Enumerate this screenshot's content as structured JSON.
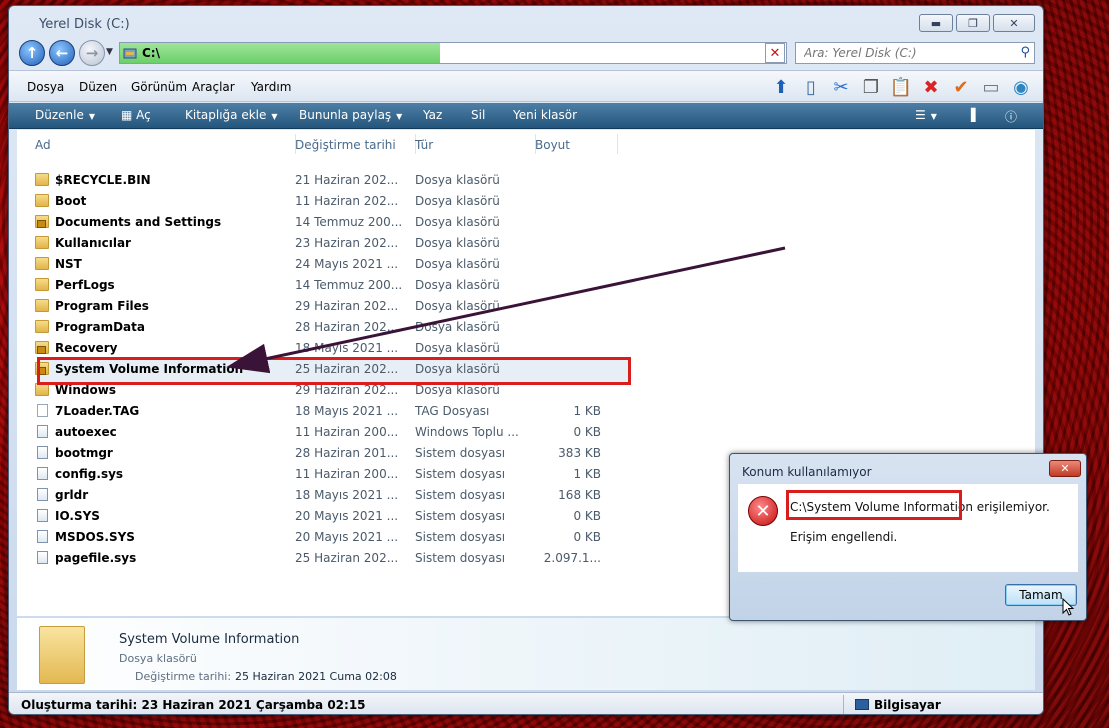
{
  "window": {
    "title": "Yerel Disk (C:)",
    "caption": {
      "minimize": "▬",
      "maximize": "❐",
      "close": "✕"
    }
  },
  "address": {
    "path": "C:\\",
    "search_placeholder": "Ara: Yerel Disk (C:)"
  },
  "menubar": [
    "Dosya",
    "Düzen",
    "Görünüm",
    "Araçlar",
    "Yardım"
  ],
  "commands": {
    "organize": "Düzenle",
    "open": "Aç",
    "library": "Kitaplığa ekle",
    "share": "Bununla paylaş",
    "print": "Yaz",
    "delete": "Sil",
    "new_folder": "Yeni klasör"
  },
  "columns": {
    "name": "Ad",
    "date": "Değiştirme tarihi",
    "type": "Tür",
    "size": "Boyut"
  },
  "files": [
    {
      "name": "$RECYCLE.BIN",
      "date": "21 Haziran 202...",
      "type": "Dosya klasörü",
      "size": "",
      "icon": "folder"
    },
    {
      "name": "Boot",
      "date": "11 Haziran 202...",
      "type": "Dosya klasörü",
      "size": "",
      "icon": "folder"
    },
    {
      "name": "Documents and Settings",
      "date": "14 Temmuz 200...",
      "type": "Dosya klasörü",
      "size": "",
      "icon": "locked-folder"
    },
    {
      "name": "Kullanıcılar",
      "date": "23 Haziran 202...",
      "type": "Dosya klasörü",
      "size": "",
      "icon": "folder"
    },
    {
      "name": "NST",
      "date": "24 Mayıs 2021 ...",
      "type": "Dosya klasörü",
      "size": "",
      "icon": "folder"
    },
    {
      "name": "PerfLogs",
      "date": "14 Temmuz 200...",
      "type": "Dosya klasörü",
      "size": "",
      "icon": "folder"
    },
    {
      "name": "Program Files",
      "date": "29 Haziran 202...",
      "type": "Dosya klasörü",
      "size": "",
      "icon": "folder"
    },
    {
      "name": "ProgramData",
      "date": "28 Haziran 202...",
      "type": "Dosya klasörü",
      "size": "",
      "icon": "folder"
    },
    {
      "name": "Recovery",
      "date": "18 Mayıs 2021 ...",
      "type": "Dosya klasörü",
      "size": "",
      "icon": "locked-folder"
    },
    {
      "name": "System Volume Information",
      "date": "25 Haziran 202...",
      "type": "Dosya klasörü",
      "size": "",
      "icon": "locked-folder"
    },
    {
      "name": "Windows",
      "date": "29 Haziran 202...",
      "type": "Dosya klasörü",
      "size": "",
      "icon": "folder"
    },
    {
      "name": "7Loader.TAG",
      "date": "18 Mayıs 2021 ...",
      "type": "TAG Dosyası",
      "size": "1 KB",
      "icon": "file"
    },
    {
      "name": "autoexec",
      "date": "11 Haziran 200...",
      "type": "Windows Toplu ...",
      "size": "0 KB",
      "icon": "system-file"
    },
    {
      "name": "bootmgr",
      "date": "28 Haziran 201...",
      "type": "Sistem dosyası",
      "size": "383 KB",
      "icon": "system-file"
    },
    {
      "name": "config.sys",
      "date": "11 Haziran 200...",
      "type": "Sistem dosyası",
      "size": "1 KB",
      "icon": "system-file"
    },
    {
      "name": "grldr",
      "date": "18 Mayıs 2021 ...",
      "type": "Sistem dosyası",
      "size": "168 KB",
      "icon": "system-file"
    },
    {
      "name": "IO.SYS",
      "date": "20 Mayıs 2021 ...",
      "type": "Sistem dosyası",
      "size": "0 KB",
      "icon": "system-file"
    },
    {
      "name": "MSDOS.SYS",
      "date": "20 Mayıs 2021 ...",
      "type": "Sistem dosyası",
      "size": "0 KB",
      "icon": "system-file"
    },
    {
      "name": "pagefile.sys",
      "date": "25 Haziran 202...",
      "type": "Sistem dosyası",
      "size": "2.097.1...",
      "icon": "system-file"
    }
  ],
  "details": {
    "name": "System Volume Information",
    "type": "Dosya klasörü",
    "modified_label": "Değiştirme tarihi:",
    "modified_value": "25 Haziran 2021 Cuma 02:08"
  },
  "status": {
    "created": "Oluşturma tarihi: 23 Haziran 2021 Çarşamba 02:15",
    "location": "Bilgisayar"
  },
  "dialog": {
    "title": "Konum kullanılamıyor",
    "message_path": "C:\\System Volume Information",
    "message_rest": "erişilemiyor.",
    "message2": "Erişim engellendi.",
    "ok": "Tamam"
  },
  "colors": {
    "accent": "#24557c",
    "highlight": "#d91c1c",
    "desktop": "#8a0000"
  }
}
